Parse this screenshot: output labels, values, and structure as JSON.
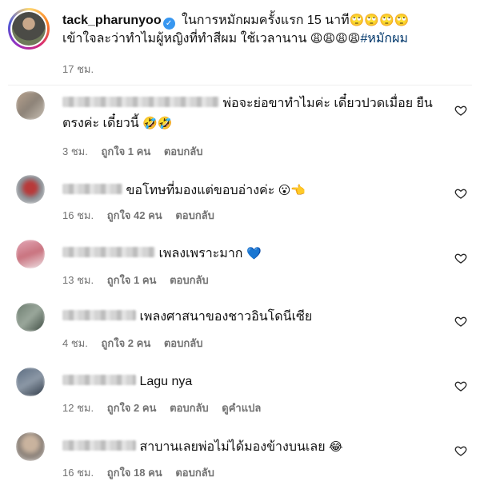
{
  "post": {
    "username": "tack_pharunyoo",
    "caption_line1": "ในการหมักผมครั้งแรก 15 นาที",
    "emoji_line1": "🙄🙄🙄🙄",
    "caption_line2": "เข้าใจละว่าทำไมผู้หญิงที่ทำสีผม ใช้เวลานาน",
    "emoji_line2": "😩😩😩😩",
    "hashtag": "#หมักผม",
    "time": "17 ชม."
  },
  "comments": [
    {
      "text": "พ่อจะย่อขาทำไมค่ะ เดี๋ยวปวดเมื่อย ยืนตรงค่ะ เดี๋ยวนี้",
      "emoji": "🤣🤣",
      "time": "3 ชม.",
      "likes": "ถูกใจ 1 คน",
      "reply": "ตอบกลับ",
      "translate": ""
    },
    {
      "text": "ขอโทษที่มองแต่ขอบอ่างค่ะ",
      "emoji": "😮👈",
      "time": "16 ชม.",
      "likes": "ถูกใจ 42 คน",
      "reply": "ตอบกลับ",
      "translate": ""
    },
    {
      "text": "เพลงเพราะมาก",
      "emoji": "💙",
      "time": "13 ชม.",
      "likes": "ถูกใจ 1 คน",
      "reply": "ตอบกลับ",
      "translate": ""
    },
    {
      "text": "เพลงศาสนาของชาวอินโดนีเซีย",
      "emoji": "",
      "time": "4 ชม.",
      "likes": "ถูกใจ 2 คน",
      "reply": "ตอบกลับ",
      "translate": ""
    },
    {
      "text": "Lagu nya",
      "emoji": "",
      "time": "12 ชม.",
      "likes": "ถูกใจ 2 คน",
      "reply": "ตอบกลับ",
      "translate": "ดูคำแปล"
    },
    {
      "text": "สาบานเลยพ่อไม่ได้มองข้างบนเลย",
      "emoji": "😂",
      "time": "16 ชม.",
      "likes": "ถูกใจ 18 คน",
      "reply": "ตอบกลับ",
      "translate": ""
    }
  ],
  "colors": {
    "verified": "#3897f0",
    "hashtag": "#00376b",
    "meta": "#737373"
  }
}
